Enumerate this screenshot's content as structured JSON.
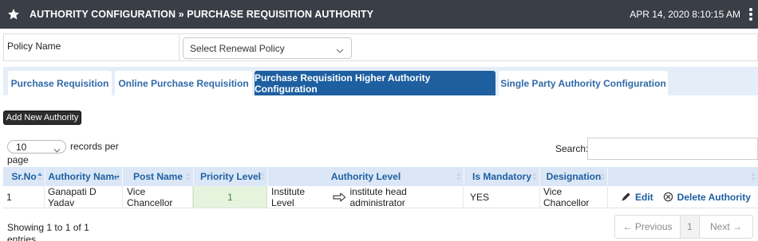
{
  "header": {
    "title": "AUTHORITY CONFIGURATION » PURCHASE REQUISITION AUTHORITY",
    "datetime": "APR 14, 2020  8:10:15 AM"
  },
  "policy": {
    "label": "Policy Name",
    "select_value": "Select Renewal Policy"
  },
  "tabs": [
    {
      "label": "Purchase Requisition",
      "active": false
    },
    {
      "label": "Online Purchase Requisition",
      "active": false
    },
    {
      "label": "Purchase Requisition Higher Authority Configuration",
      "active": true
    },
    {
      "label": "Single Party Authority Configuration",
      "active": false
    }
  ],
  "toolbar": {
    "add_label": "Add New Authority"
  },
  "table_controls": {
    "length_value": "10",
    "length_label_1": "records per",
    "length_label_2": "page",
    "search_label": "Search:",
    "search_value": ""
  },
  "table": {
    "columns": [
      "Sr.No",
      "Authority Name",
      "Post Name",
      "Priority Level",
      "Authority Level",
      "Is Mandatory",
      "Designation",
      ""
    ],
    "rows": [
      {
        "sr_no": "1",
        "authority_name": "Ganapati D Yadav",
        "post_name": "Vice Chancellor",
        "priority_level": "1",
        "authority_level_from": "Institute Level",
        "authority_level_to": "institute head administrator",
        "is_mandatory": "YES",
        "designation": "Vice Chancellor",
        "edit_label": "Edit",
        "delete_label": "Delete Authority"
      }
    ]
  },
  "footer": {
    "info_1": "Showing 1 to 1 of 1",
    "info_2": "entries",
    "prev_label": "← Previous",
    "page": "1",
    "next_label": "Next →"
  },
  "colors": {
    "topbar": "#3a3e47",
    "accent": "#1e5fa0",
    "tab_bar": "#e5eef8",
    "table_header": "#dbe7f6",
    "priority_cell": "#e6f4dd"
  },
  "icons": [
    "star-icon",
    "kebab-menu-icon",
    "chevron-down-icon",
    "sort-icon",
    "arrow-right-icon",
    "pencil-icon",
    "delete-icon"
  ]
}
